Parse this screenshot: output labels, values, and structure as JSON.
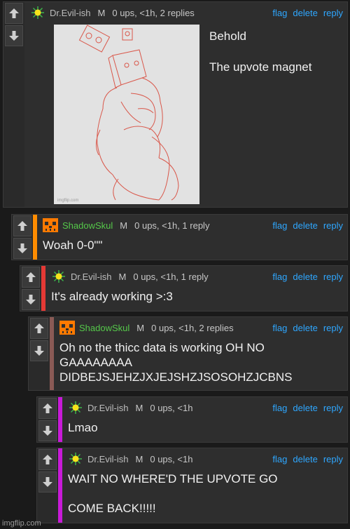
{
  "actions": {
    "flag": "flag",
    "delete": "delete",
    "reply": "reply"
  },
  "comments": [
    {
      "user": "Dr.Evil-ish",
      "badge": "M",
      "meta": "0 ups, <1h, 2 replies",
      "text": "Behold\n\nThe upvote magnet",
      "image_caption": "imgflip.com"
    },
    {
      "user": "ShadowSkul",
      "badge": "M",
      "meta": "0 ups, <1h, 1 reply",
      "text": "Woah 0-0\"\""
    },
    {
      "user": "Dr.Evil-ish",
      "badge": "M",
      "meta": "0 ups, <1h, 1 reply",
      "text": "It's already working >:3"
    },
    {
      "user": "ShadowSkul",
      "badge": "M",
      "meta": "0 ups, <1h, 2 replies",
      "text": "Oh no the thicc data is working OH NO\nGAAAAAAAA\nDIDBEJSJEHZJXJEJSHZJSOSOHZJCBNS"
    },
    {
      "user": "Dr.Evil-ish",
      "badge": "M",
      "meta": "0 ups, <1h",
      "text": "Lmao"
    },
    {
      "user": "Dr.Evil-ish",
      "badge": "M",
      "meta": "0 ups, <1h",
      "text": "WAIT NO WHERE'D THE UPVOTE GO\n\nCOME BACK!!!!!"
    }
  ],
  "colors": {
    "bar_orange": "#ff8c00",
    "bar_red": "#e53935",
    "bar_brown": "#8a5a55",
    "bar_magenta": "#c81ad8",
    "link": "#2ea7ff"
  },
  "watermark": "imgflip.com"
}
